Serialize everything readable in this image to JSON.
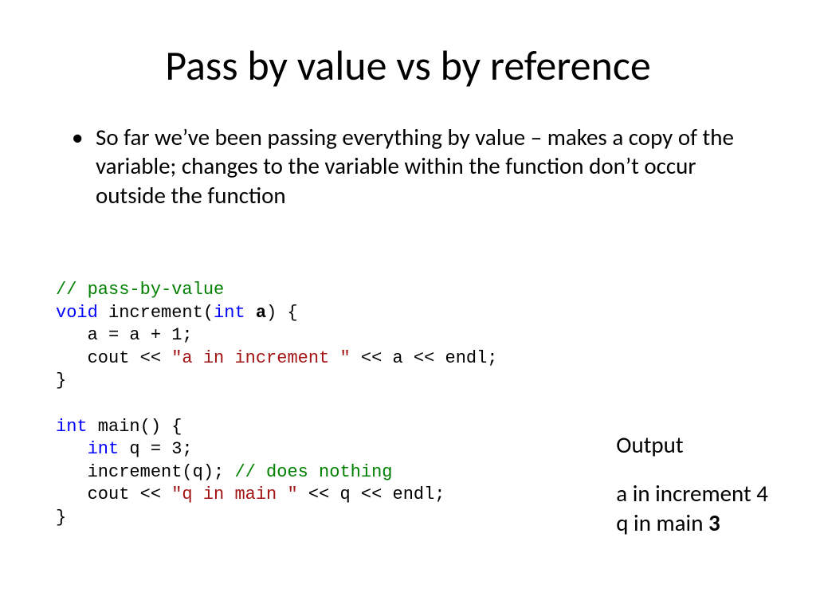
{
  "title": "Pass by value vs by reference",
  "bullet": "So far we’ve been passing everything by value – makes a copy of the variable; changes to the variable within the function don’t occur outside the function",
  "code": {
    "l1": "// pass-by-value",
    "l2a": "void",
    "l2b": " increment(",
    "l2c": "int",
    "l2d": " ",
    "l2e": "a",
    "l2f": ") {",
    "l3": "   a = a + 1;",
    "l4a": "   cout << ",
    "l4b": "\"a in increment \"",
    "l4c": " << a << endl;",
    "l5": "}",
    "l7a": "int",
    "l7b": " main() {",
    "l8a": "   ",
    "l8b": "int",
    "l8c": " q = 3;",
    "l9a": "   increment(q); ",
    "l9b": "// does nothing",
    "l10a": "   cout << ",
    "l10b": "\"q in main \"",
    "l10c": " << q << endl;",
    "l11": "}"
  },
  "output": {
    "heading": "Output",
    "line1a": "a in increment ",
    "line1b": "4",
    "line2a": "q in main ",
    "line2b": "3"
  }
}
